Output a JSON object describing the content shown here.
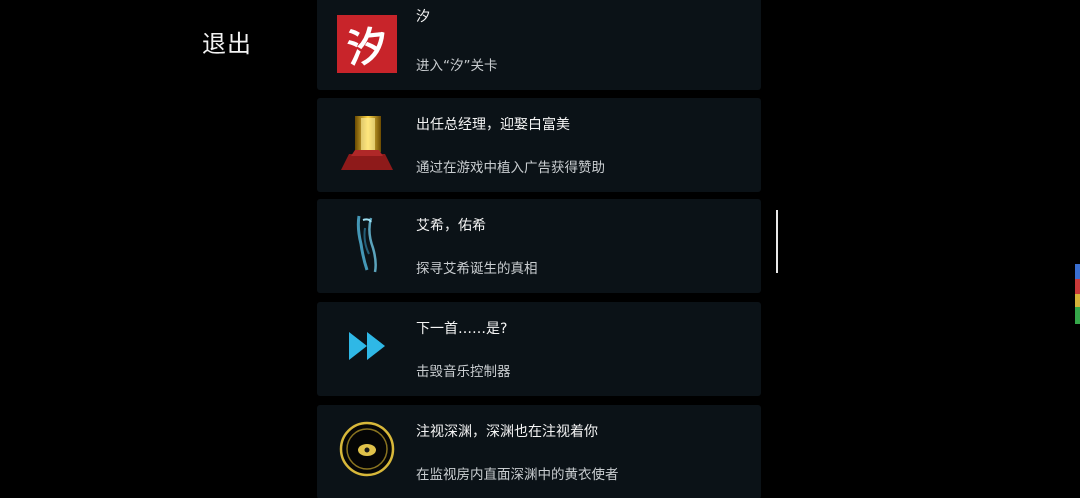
{
  "exit_label": "退出",
  "achievements": [
    {
      "title": "汐",
      "desc": "进入“汐”关卡",
      "icon": "xi-character-icon",
      "icon_text": "汐"
    },
    {
      "title": "出任总经理，迎娶白富美",
      "desc": "通过在游戏中植入广告获得赞助",
      "icon": "golden-trophy-icon"
    },
    {
      "title": "艾希，佑希",
      "desc": "探寻艾希诞生的真相",
      "icon": "ghost-figure-icon"
    },
    {
      "title": "下一首……是?",
      "desc": "击毁音乐控制器",
      "icon": "fast-forward-icon"
    },
    {
      "title": "注视深渊，深渊也在注视着你",
      "desc": "在监视房内直面深渊中的黄衣使者",
      "icon": "yellow-eye-emblem-icon"
    }
  ],
  "colors": {
    "background": "#000000",
    "row": "#0b1217",
    "accent_cyan": "#2fb8e6",
    "accent_gold": "#d8b83a",
    "badge_red": "#c8242a"
  }
}
